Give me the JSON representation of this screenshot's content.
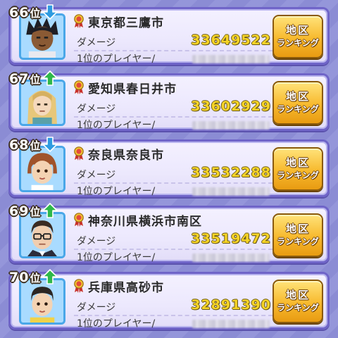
{
  "labels": {
    "damage": "ダメージ",
    "top_player": "1位のプレイヤー/",
    "button_line1": "地区",
    "button_line2": "ランキング"
  },
  "rows": [
    {
      "rank": "66",
      "rank_suffix": "位",
      "trend": "down",
      "city": "東京都三鷹市",
      "damage": "33649522",
      "portrait": "dark-spiky-hair-boy"
    },
    {
      "rank": "67",
      "rank_suffix": "位",
      "trend": "up",
      "city": "愛知県春日井市",
      "damage": "33602929",
      "portrait": "blonde-long-hair-boy"
    },
    {
      "rank": "68",
      "rank_suffix": "位",
      "trend": "down",
      "city": "奈良県奈良市",
      "damage": "33532288",
      "portrait": "brown-hair-boy"
    },
    {
      "rank": "69",
      "rank_suffix": "位",
      "trend": "up",
      "city": "神奈川県横浜市南区",
      "damage": "33519472",
      "portrait": "glasses-man"
    },
    {
      "rank": "70",
      "rank_suffix": "位",
      "trend": "up",
      "city": "兵庫県高砂市",
      "damage": "32891390",
      "portrait": "short-dark-hair-boy"
    }
  ],
  "colors": {
    "trend_up": "#2fb84a",
    "trend_down": "#2f9be0",
    "damage_text": "#f6d427",
    "button_gold": "#f7b92d"
  },
  "icons": {
    "medal": "medal-ribbon-icon",
    "trend_up": "arrow-up-icon",
    "trend_down": "arrow-down-icon"
  }
}
